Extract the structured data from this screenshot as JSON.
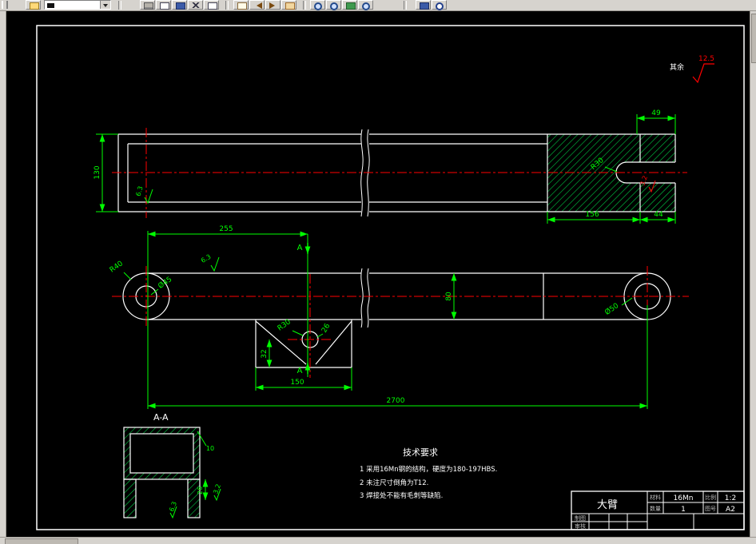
{
  "toolbar": {
    "layer_combo_value": "",
    "icons": [
      "open-icon",
      "print-icon",
      "print-preview-icon",
      "spell-check-icon",
      "cut-icon",
      "copy-icon",
      "paste-icon",
      "undo-icon",
      "redo-icon",
      "pan-icon",
      "zoom-realtime-icon",
      "zoom-window-icon",
      "zoom-all-icon",
      "zoom-previous-icon",
      "properties-icon",
      "help-icon"
    ]
  },
  "drawing": {
    "general_note": {
      "text": "其余",
      "roughness": "12.5"
    },
    "side_view": {
      "dim_height": "130",
      "dim_slot_depth": "49",
      "dim_head_length": "156",
      "dim_tab": "44",
      "slot_radius": "R30",
      "roughness": "6.3",
      "slot_roughness": "3.2"
    },
    "plan_view": {
      "dim_left_span": "255",
      "dim_total_length": "2700",
      "dim_width": "80",
      "dim_bracket_width": "150",
      "dim_bracket_height": "32",
      "bracket_hole_dia": "26",
      "end_radius": "R40",
      "left_hole_dia": "Ø45",
      "right_hole_dia": "Ø50",
      "bracket_radius": "R30",
      "roughness": "6.3",
      "section_letter": "A"
    },
    "section_view": {
      "label": "A-A",
      "dim_wall": "10",
      "dim_leg": "26",
      "roughness_wall": "3.2",
      "roughness_leg": "6.3"
    },
    "tech_requirements": {
      "title": "技术要求",
      "item_1": "1  采用16Mn钢的结构，硬度为180-197HBS.",
      "item_2": "2  未注尺寸倒角为T12.",
      "item_3": "3  焊接处不能有毛刺等缺陷."
    },
    "title_block": {
      "part_name": "大臂",
      "material_label": "材料",
      "material": "16Mn",
      "scale_label": "比例",
      "scale": "1:2",
      "quantity_label": "数量",
      "quantity": "1",
      "sheet_label": "图号",
      "sheet": "A2",
      "sign_row_1": "制图",
      "sign_row_2": "审核"
    }
  }
}
